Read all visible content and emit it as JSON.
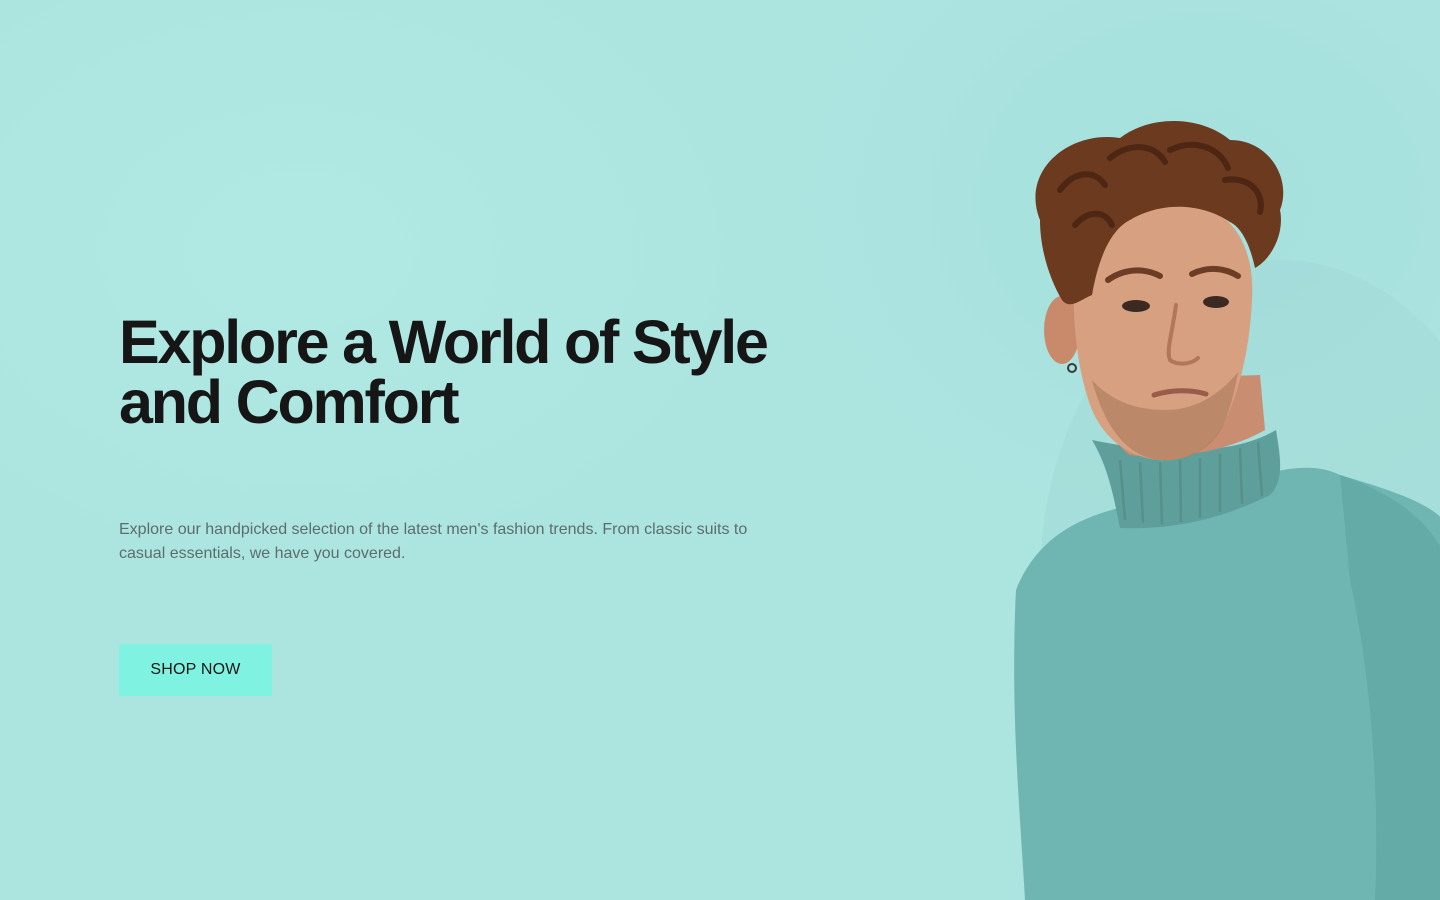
{
  "hero": {
    "headline": "Explore a World of Style and Comfort",
    "subtext": "Explore our handpicked selection of the latest men's fashion trends. From classic suits to casual essentials, we have you covered.",
    "cta_label": "SHOP NOW"
  },
  "colors": {
    "background": "#ace4e0",
    "headline": "#161616",
    "subtext": "#5b6e6c",
    "cta_background": "#7ff2e2",
    "sweater": "#6fb5b1"
  },
  "image": {
    "subject": "model-in-turtleneck-photo"
  }
}
